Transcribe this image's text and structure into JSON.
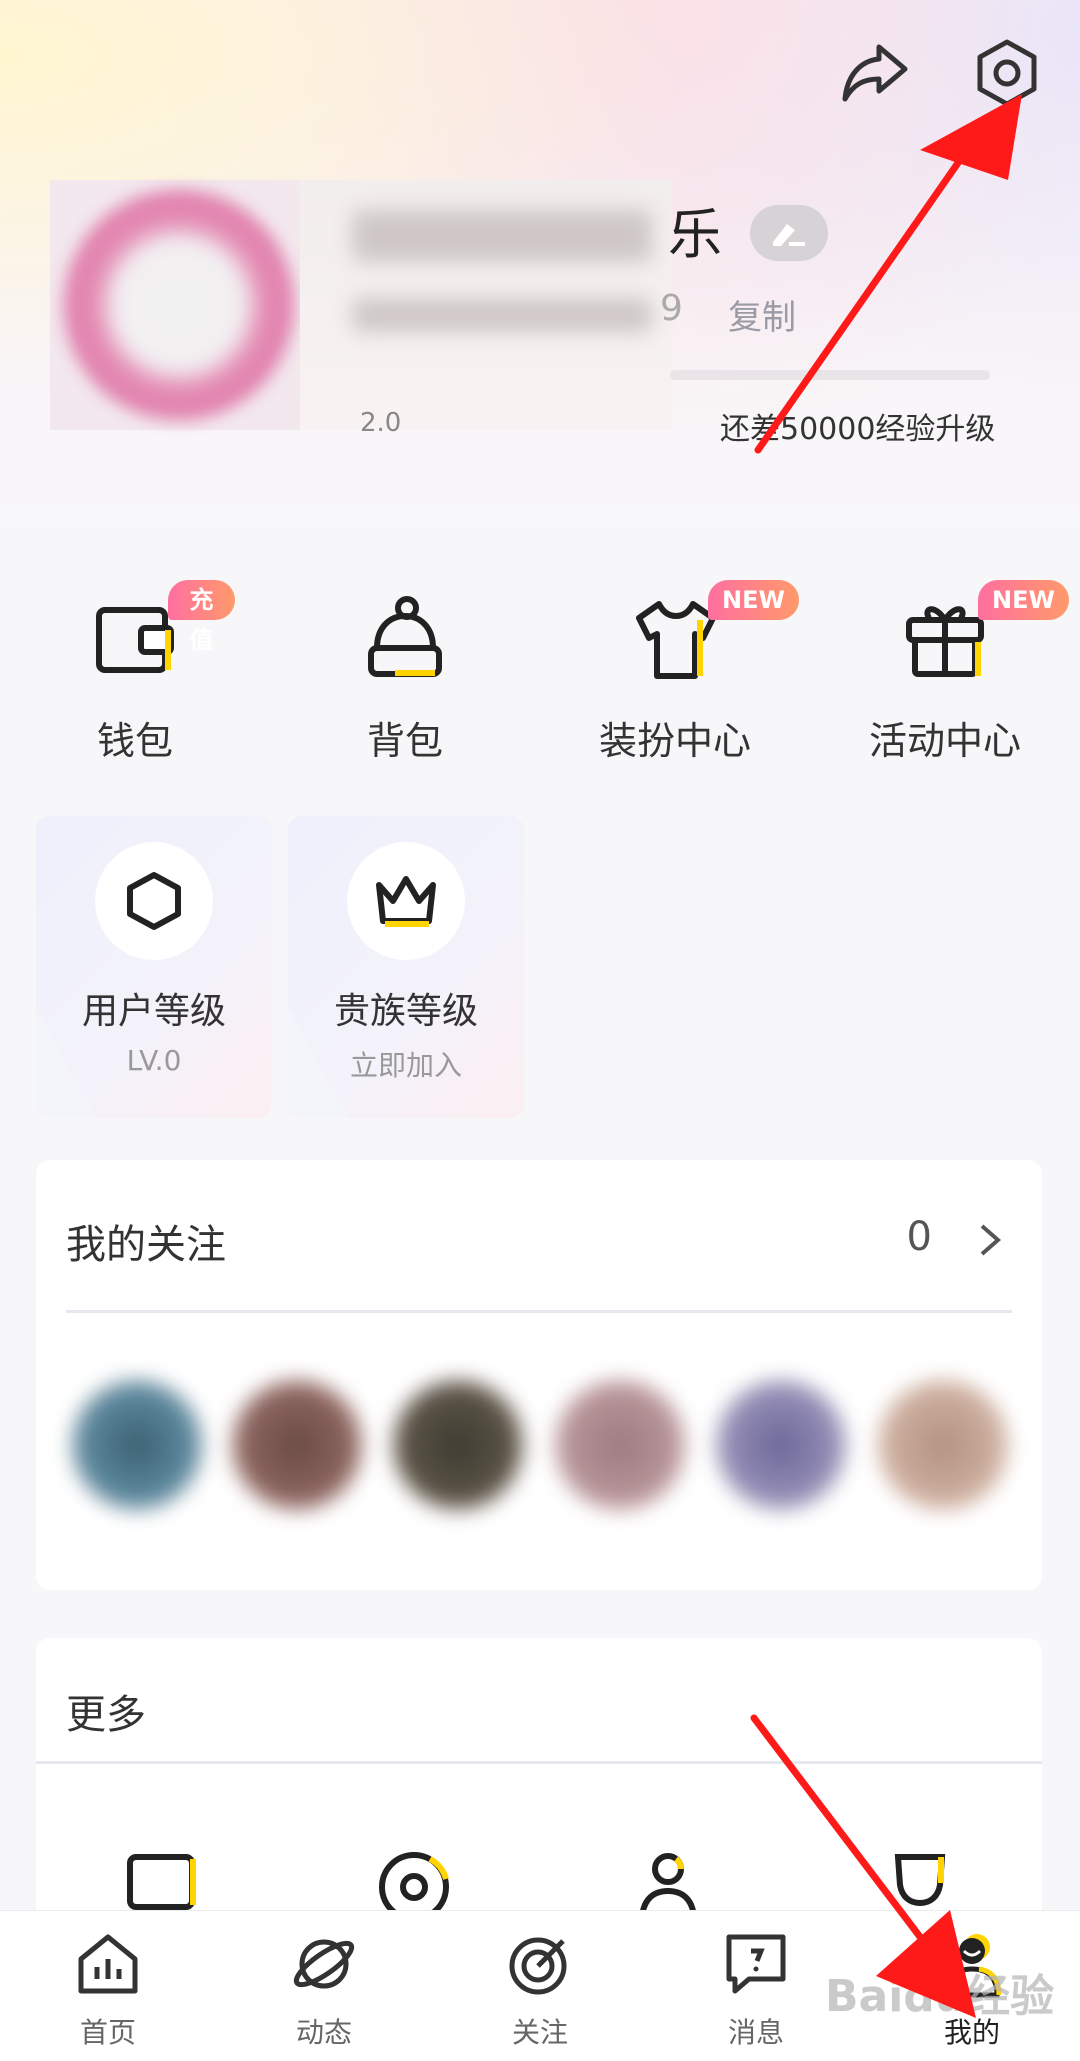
{
  "profile": {
    "name_visible_part": "乐",
    "id_visible_part": "9",
    "copy_label": "复制",
    "exp_text": "还差50000经验升级",
    "level_visible_part": "2.0"
  },
  "quick_menu": [
    {
      "label": "钱包",
      "badge": "充值",
      "icon": "wallet-icon"
    },
    {
      "label": "背包",
      "badge": "",
      "icon": "backpack-icon"
    },
    {
      "label": "装扮中心",
      "badge": "NEW",
      "icon": "tshirt-icon"
    },
    {
      "label": "活动中心",
      "badge": "NEW",
      "icon": "gift-icon"
    }
  ],
  "level_cards": [
    {
      "title": "用户等级",
      "sub": "LV.0",
      "icon": "hexagon-icon"
    },
    {
      "title": "贵族等级",
      "sub": "立即加入",
      "icon": "crown-icon"
    }
  ],
  "follow": {
    "title": "我的关注",
    "count": "0"
  },
  "more": {
    "title": "更多"
  },
  "tabs": [
    {
      "label": "首页",
      "icon": "chart-home-icon"
    },
    {
      "label": "动态",
      "icon": "planet-icon"
    },
    {
      "label": "关注",
      "icon": "target-icon"
    },
    {
      "label": "消息",
      "icon": "message-icon"
    },
    {
      "label": "我的",
      "icon": "user-icon",
      "active": true
    }
  ],
  "watermark": "Baidu经验",
  "colors": {
    "accent_yellow": "#ffd400",
    "badge_gradient_start": "#ff6fa0",
    "badge_gradient_end": "#ff9a6a",
    "arrow_red": "#ff1a1a"
  }
}
